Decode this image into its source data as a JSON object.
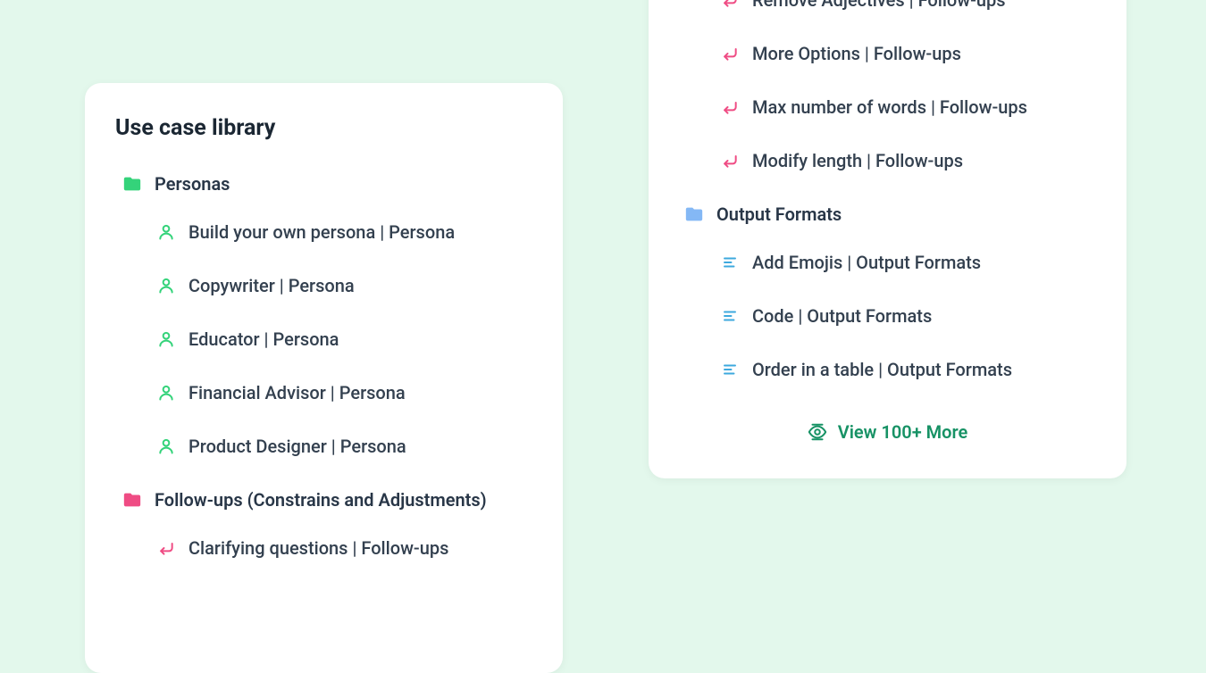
{
  "title": "Use case library",
  "colors": {
    "green": "#34d37a",
    "pink": "#ef4c84",
    "blue": "#58a6f6",
    "blue_light": "#5eb4e2",
    "teal_dark": "#179265"
  },
  "left": {
    "sections": [
      {
        "label": "Personas",
        "icon": "folder-green",
        "items": [
          {
            "icon": "person-green",
            "label": "Build your own persona | Persona"
          },
          {
            "icon": "person-green",
            "label": "Copywriter | Persona"
          },
          {
            "icon": "person-green",
            "label": "Educator | Persona"
          },
          {
            "icon": "person-green",
            "label": "Financial Advisor | Persona"
          },
          {
            "icon": "person-green",
            "label": "Product Designer | Persona"
          }
        ]
      },
      {
        "label": "Follow-ups (Constrains and Adjustments)",
        "icon": "folder-pink",
        "items": [
          {
            "icon": "return-pink",
            "label": "Clarifying questions | Follow-ups"
          }
        ]
      }
    ]
  },
  "right": {
    "top_items": [
      {
        "icon": "return-pink",
        "label": "Remove Adjectives | Follow-ups"
      },
      {
        "icon": "return-pink",
        "label": "More Options | Follow-ups"
      },
      {
        "icon": "return-pink",
        "label": "Max number of words | Follow-ups"
      },
      {
        "icon": "return-pink",
        "label": "Modify length | Follow-ups"
      }
    ],
    "section": {
      "label": "Output Formats",
      "icon": "folder-blue",
      "items": [
        {
          "icon": "lines-blue",
          "label": "Add Emojis | Output Formats"
        },
        {
          "icon": "lines-blue",
          "label": "Code | Output Formats"
        },
        {
          "icon": "lines-blue",
          "label": "Order in a table | Output Formats"
        }
      ]
    }
  },
  "view_more_label": "View 100+ More"
}
